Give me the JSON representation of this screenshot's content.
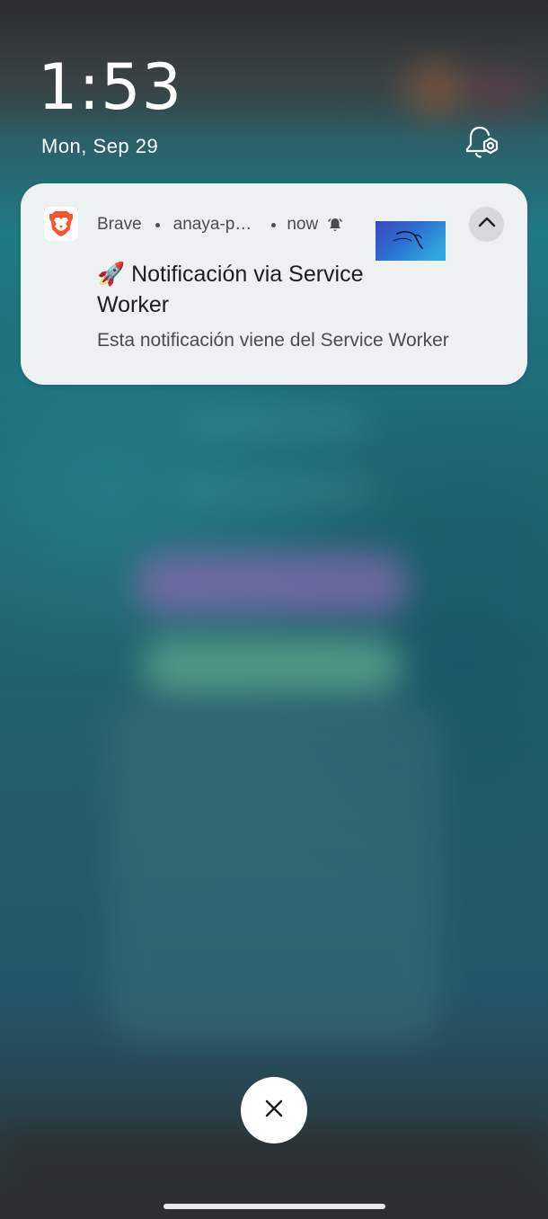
{
  "lockscreen": {
    "time": "1:53",
    "date": "Mon, Sep 29",
    "notification_settings_icon": "bell-settings-icon"
  },
  "notification": {
    "app_name": "Brave",
    "source": "anaya-p…",
    "timestamp": "now",
    "alert_icon": "bell-icon",
    "app_icon": "brave-lion-icon",
    "title": "🚀 Notificación via Service Worker",
    "body": "Esta notificación viene del Service Worker",
    "expand_icon": "chevron-up-icon"
  },
  "controls": {
    "dismiss_icon": "close-icon"
  },
  "colors": {
    "card_background": "#eef1f2",
    "brave_orange": "#fb542b",
    "background_teal": "#22606c"
  }
}
